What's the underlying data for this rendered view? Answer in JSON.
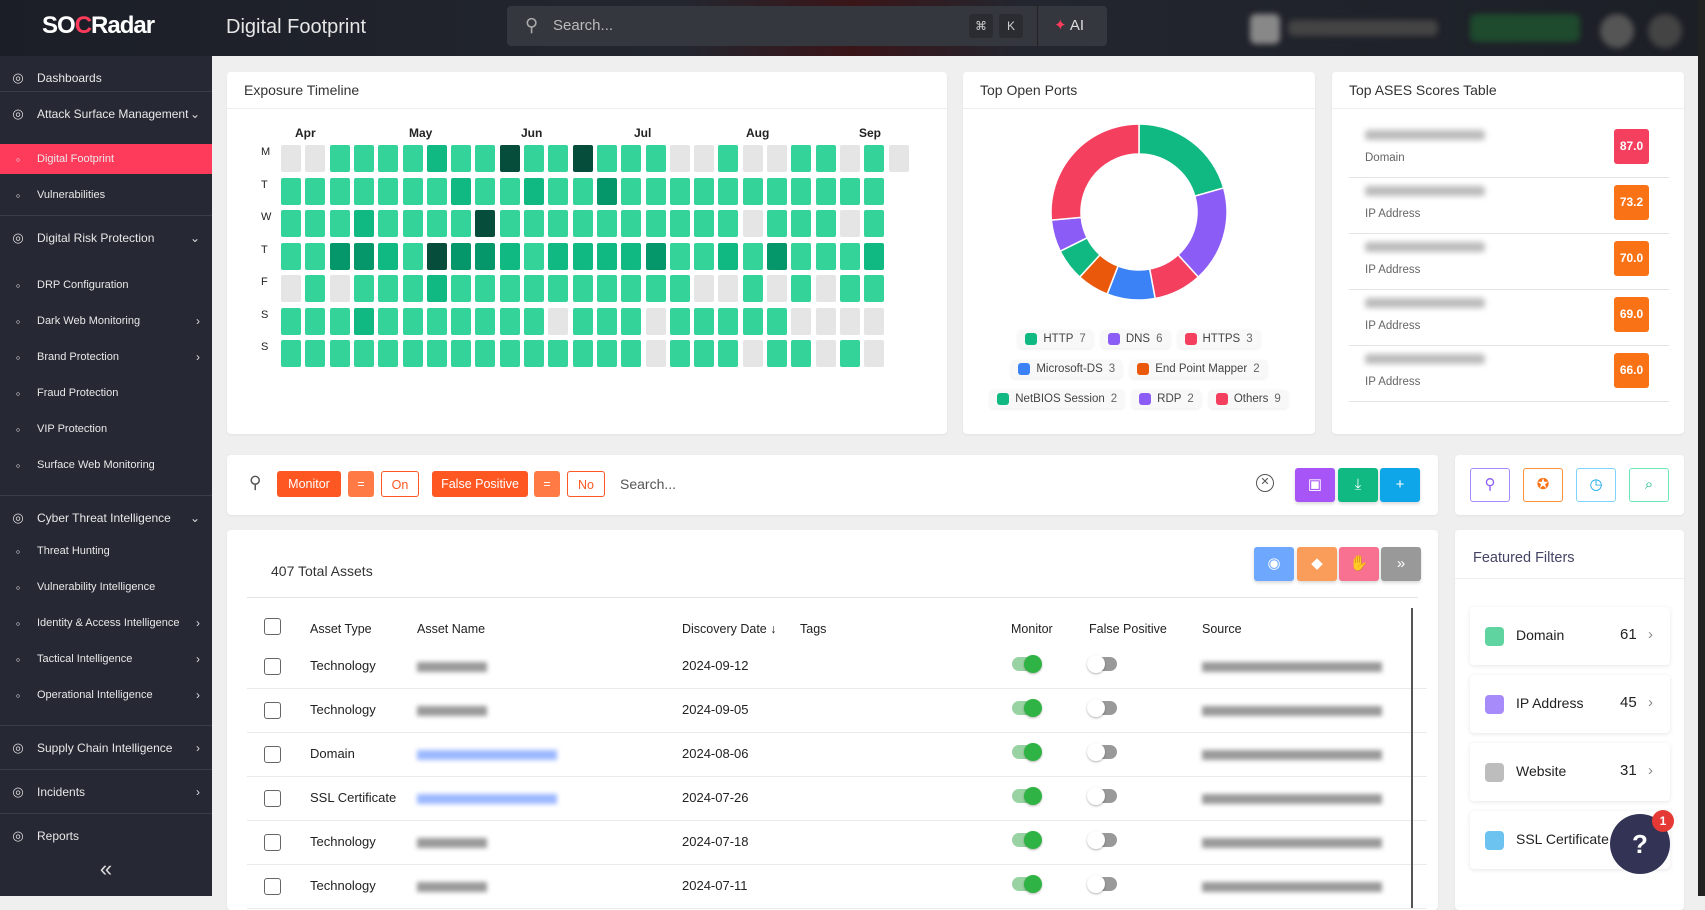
{
  "header": {
    "logo": "SOCRadar",
    "title": "Digital Footprint",
    "search_placeholder": "Search...",
    "kbd_cmd": "⌘",
    "kbd_k": "K",
    "ai_label": "AI"
  },
  "sidebar": {
    "items": [
      {
        "label": "Dashboards",
        "icon": "dashboard-icon",
        "level": "top"
      },
      {
        "label": "Attack Surface Management",
        "icon": "shield-icon",
        "level": "top",
        "chevron": "down"
      },
      {
        "label": "Digital Footprint",
        "icon": "globe-icon",
        "level": "sub",
        "active": true
      },
      {
        "label": "Vulnerabilities",
        "icon": "bug-icon",
        "level": "sub"
      },
      {
        "label": "Digital Risk Protection",
        "icon": "hand-icon",
        "level": "top",
        "chevron": "down"
      },
      {
        "label": "DRP Configuration",
        "icon": "laptop-icon",
        "level": "sub"
      },
      {
        "label": "Dark Web Monitoring",
        "icon": "monitor-icon",
        "level": "sub",
        "chevron": "right"
      },
      {
        "label": "Brand Protection",
        "icon": "brand-icon",
        "level": "sub",
        "chevron": "right"
      },
      {
        "label": "Fraud Protection",
        "icon": "card-icon",
        "level": "sub"
      },
      {
        "label": "VIP Protection",
        "icon": "vip-icon",
        "level": "sub"
      },
      {
        "label": "Surface Web Monitoring",
        "icon": "lock-icon",
        "level": "sub"
      },
      {
        "label": "Cyber Threat Intelligence",
        "icon": "eye-shield-icon",
        "level": "top",
        "chevron": "down"
      },
      {
        "label": "Threat Hunting",
        "icon": "search-icon",
        "level": "sub"
      },
      {
        "label": "Vulnerability Intelligence",
        "icon": "bug-icon",
        "level": "sub"
      },
      {
        "label": "Identity & Access Intelligence",
        "icon": "fingerprint-icon",
        "level": "sub",
        "chevron": "right"
      },
      {
        "label": "Tactical Intelligence",
        "icon": "chess-icon",
        "level": "sub",
        "chevron": "right"
      },
      {
        "label": "Operational Intelligence",
        "icon": "gear-icon",
        "level": "sub",
        "chevron": "right"
      },
      {
        "label": "Supply Chain Intelligence",
        "icon": "building-icon",
        "level": "top",
        "chevron": "right"
      },
      {
        "label": "Incidents",
        "icon": "alert-icon",
        "level": "top",
        "chevron": "right"
      },
      {
        "label": "Reports",
        "icon": "report-icon",
        "level": "top"
      }
    ],
    "collapse": "«"
  },
  "timeline": {
    "title": "Exposure Timeline",
    "months": [
      "Apr",
      "May",
      "Jun",
      "Jul",
      "Aug",
      "Sep"
    ],
    "days": [
      "M",
      "T",
      "W",
      "T",
      "F",
      "S",
      "S"
    ],
    "levels": [
      [
        0,
        0,
        1,
        1,
        1,
        1,
        2,
        1,
        1,
        4,
        1,
        1,
        4,
        1,
        1,
        1,
        0,
        0,
        1,
        0,
        0,
        1,
        1,
        0,
        1,
        0
      ],
      [
        1,
        1,
        1,
        1,
        1,
        1,
        1,
        2,
        1,
        1,
        2,
        1,
        1,
        3,
        1,
        1,
        1,
        1,
        1,
        1,
        1,
        1,
        1,
        1,
        1
      ],
      [
        1,
        1,
        1,
        2,
        1,
        1,
        1,
        1,
        4,
        1,
        1,
        1,
        1,
        1,
        1,
        1,
        1,
        1,
        1,
        0,
        1,
        1,
        1,
        0,
        1
      ],
      [
        1,
        1,
        3,
        3,
        2,
        1,
        4,
        3,
        3,
        2,
        1,
        2,
        2,
        2,
        2,
        3,
        1,
        1,
        2,
        1,
        3,
        1,
        1,
        1,
        2
      ],
      [
        0,
        1,
        0,
        1,
        1,
        1,
        2,
        1,
        1,
        1,
        1,
        1,
        1,
        1,
        1,
        1,
        1,
        0,
        0,
        1,
        0,
        1,
        0,
        1,
        1
      ],
      [
        1,
        1,
        1,
        2,
        1,
        1,
        1,
        1,
        1,
        1,
        1,
        0,
        1,
        1,
        1,
        0,
        1,
        1,
        1,
        1,
        1,
        0,
        0,
        0,
        0
      ],
      [
        1,
        1,
        1,
        1,
        1,
        1,
        1,
        1,
        1,
        1,
        1,
        1,
        1,
        1,
        1,
        0,
        1,
        1,
        1,
        0,
        1,
        1,
        0,
        1,
        0
      ]
    ],
    "level_colors": [
      "#e5e5e5",
      "#34d399",
      "#10b981",
      "#059669",
      "#064e3b"
    ]
  },
  "chart_data": {
    "type": "pie",
    "title": "Top Open Ports",
    "categories": [
      "HTTP",
      "DNS",
      "HTTPS",
      "Microsoft-DS",
      "End Point Mapper",
      "NetBIOS Session",
      "RDP",
      "Others"
    ],
    "values": [
      7,
      6,
      3,
      3,
      2,
      2,
      2,
      9
    ],
    "colors": [
      "#10b981",
      "#8b5cf6",
      "#f43f5e",
      "#3b82f6",
      "#ea580c",
      "#10b981",
      "#8b5cf6",
      "#f43f5e"
    ],
    "donut": true,
    "legend": "bottom"
  },
  "ases": {
    "title": "Top ASES Scores Table",
    "rows": [
      {
        "type": "Domain",
        "score": "87.0",
        "color": "#f43f5e"
      },
      {
        "type": "IP Address",
        "score": "73.2",
        "color": "#f97316"
      },
      {
        "type": "IP Address",
        "score": "70.0",
        "color": "#f97316"
      },
      {
        "type": "IP Address",
        "score": "69.0",
        "color": "#f97316"
      },
      {
        "type": "IP Address",
        "score": "66.0",
        "color": "#f97316"
      }
    ]
  },
  "filters": {
    "chips": [
      "Monitor",
      "=",
      "On",
      "False Positive",
      "=",
      "No"
    ],
    "search_placeholder": "Search..."
  },
  "table": {
    "total": "407 Total Assets",
    "columns": [
      "Asset Type",
      "Asset Name",
      "Discovery Date ↓",
      "Tags",
      "Monitor",
      "False Positive",
      "Source"
    ],
    "rows": [
      {
        "type": "Technology",
        "date": "2024-09-12",
        "monitor": true,
        "false_positive": false
      },
      {
        "type": "Technology",
        "date": "2024-09-05",
        "monitor": true,
        "false_positive": false
      },
      {
        "type": "Domain",
        "date": "2024-08-06",
        "monitor": true,
        "false_positive": false
      },
      {
        "type": "SSL Certificate",
        "date": "2024-07-26",
        "monitor": true,
        "false_positive": false
      },
      {
        "type": "Technology",
        "date": "2024-07-18",
        "monitor": true,
        "false_positive": false
      },
      {
        "type": "Technology",
        "date": "2024-07-11",
        "monitor": true,
        "false_positive": false
      }
    ]
  },
  "featured": {
    "title": "Featured Filters",
    "items": [
      {
        "label": "Domain",
        "count": "61",
        "color": "#5fd3a0"
      },
      {
        "label": "IP Address",
        "count": "45",
        "color": "#a78bfa"
      },
      {
        "label": "Website",
        "count": "31",
        "color": "#bdbdbd"
      },
      {
        "label": "SSL Certificate",
        "count": "",
        "color": "#6cc3f0"
      }
    ]
  },
  "help": {
    "badge": "1"
  }
}
